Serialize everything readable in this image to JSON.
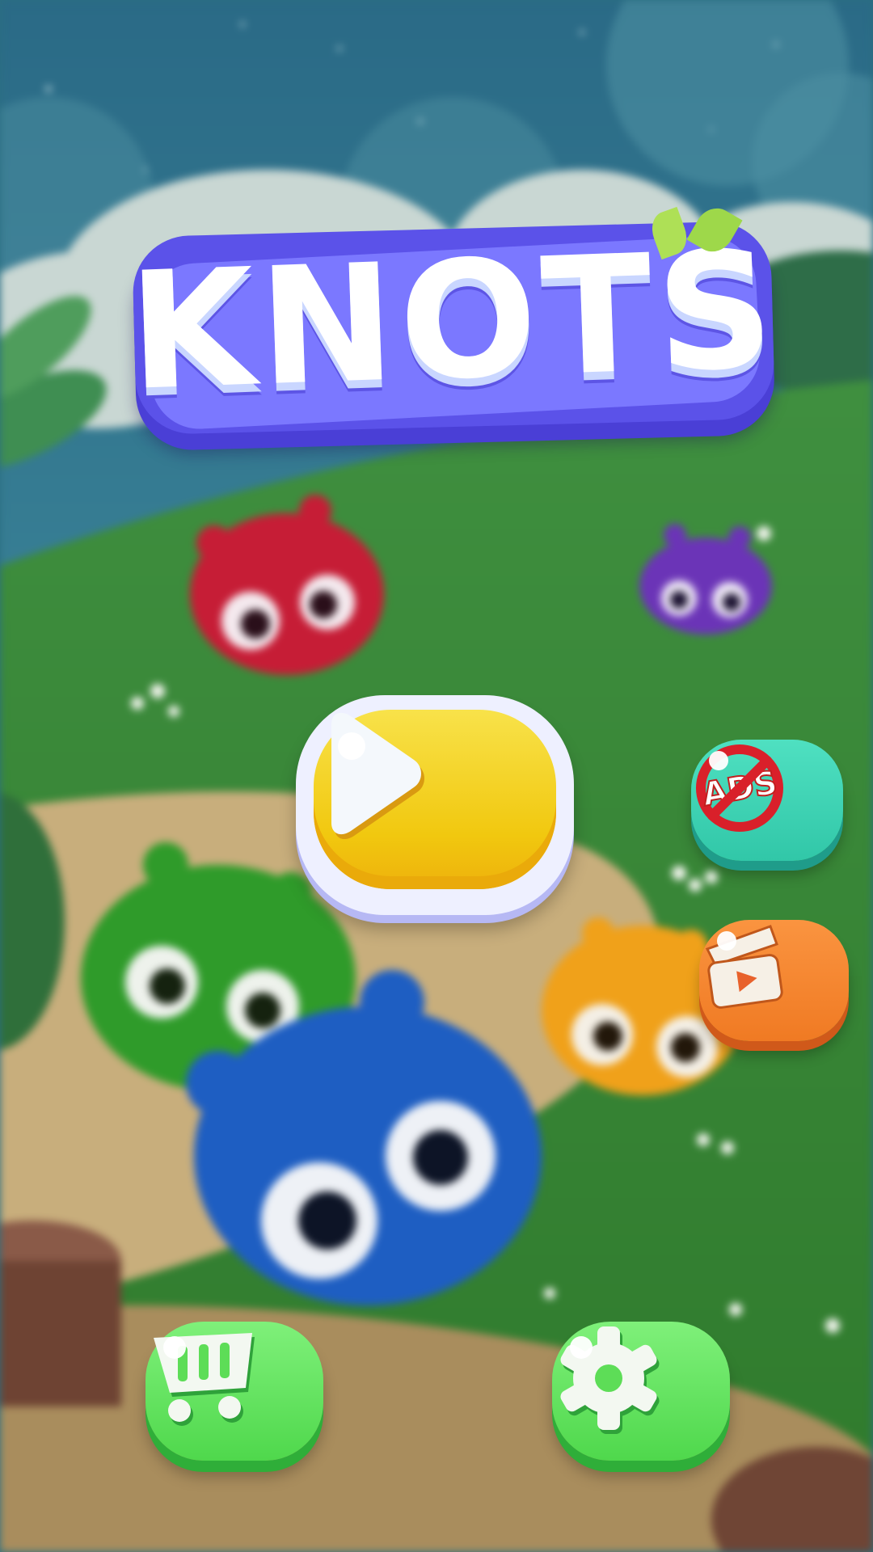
{
  "title": {
    "logo_text": "KNOTS"
  },
  "buttons": {
    "play": {
      "icon": "play-icon"
    },
    "remove_ads": {
      "icon": "no-ads-icon",
      "label": "ADS"
    },
    "watch_video": {
      "icon": "video-reward-icon"
    },
    "shop": {
      "icon": "shopping-cart-icon"
    },
    "settings": {
      "icon": "gear-icon"
    }
  },
  "colors": {
    "logo": "#6e6af8",
    "play": "#f5d11e",
    "remove_ads": "#3fd4b6",
    "watch_video": "#f5862e",
    "shop": "#5ddd57",
    "settings": "#5ddd57"
  }
}
